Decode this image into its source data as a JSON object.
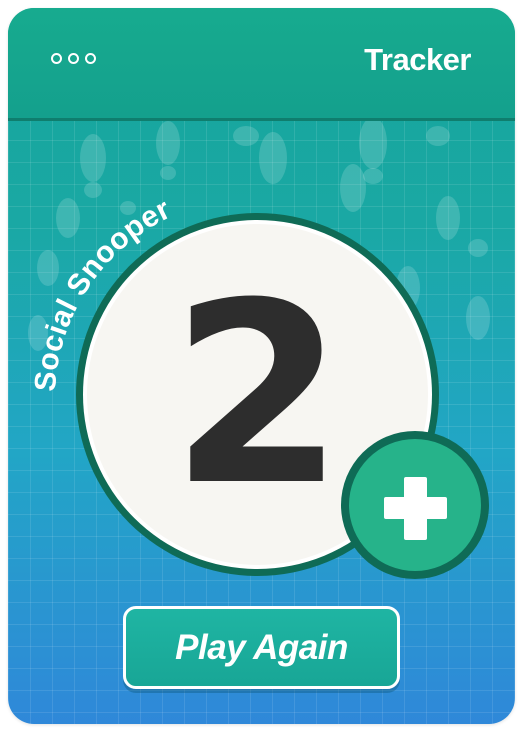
{
  "header": {
    "title": "Tracker",
    "menu_icon": "more-dots-icon"
  },
  "counter": {
    "label": "Social Snooper",
    "value": "2",
    "increment_icon": "plus-icon"
  },
  "footer": {
    "play_again_label": "Play Again"
  },
  "colors": {
    "header_green": "#17ab8f",
    "ring_dark_green": "#0f6b56",
    "accent_green": "#26b38a",
    "count_text": "#2d2d2d",
    "bg_bottom_blue": "#2f88d9"
  },
  "decoration": {
    "background_icon": "footprints-icon"
  }
}
